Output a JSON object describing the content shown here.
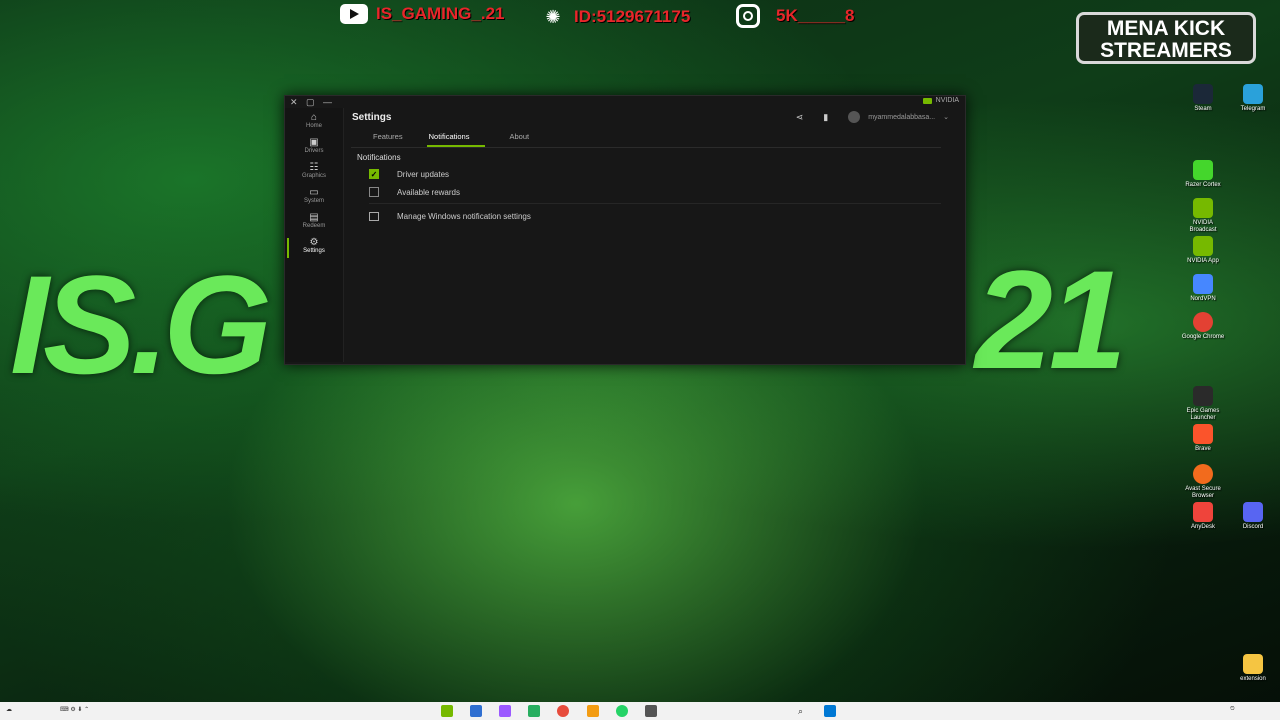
{
  "wallpaper": {
    "big_left": "IS.G",
    "big_right": "21"
  },
  "socials": {
    "youtube": "IS_GAMING_.21",
    "id": "ID:5129671175",
    "instagram": "5K_____8"
  },
  "badge": {
    "line1": "MENA KICK",
    "line2": "STREAMERS"
  },
  "window": {
    "brand": "NVIDIA",
    "title": "Settings",
    "user": "myammedalabbasa...",
    "nav": [
      {
        "label": "Home",
        "icon": "home-icon",
        "glyph": "⌂"
      },
      {
        "label": "Drivers",
        "icon": "drivers-icon",
        "glyph": "▣"
      },
      {
        "label": "Graphics",
        "icon": "graphics-icon",
        "glyph": "☷"
      },
      {
        "label": "System",
        "icon": "system-icon",
        "glyph": "▭"
      },
      {
        "label": "Redeem",
        "icon": "redeem-icon",
        "glyph": "▤"
      },
      {
        "label": "Settings",
        "icon": "gear-icon",
        "glyph": "⚙"
      }
    ],
    "tabs": [
      "Features",
      "Notifications",
      "About"
    ],
    "active_tab": "Notifications",
    "section_title": "Notifications",
    "options": [
      {
        "label": "Driver updates",
        "checked": true
      },
      {
        "label": "Available rewards",
        "checked": false
      }
    ],
    "link": "Manage Windows notification settings"
  },
  "accent_color": "#76b900",
  "desktop_icons": [
    {
      "label": "Steam",
      "color": "#1b2838"
    },
    {
      "label": "Telegram",
      "color": "#2aa1da"
    },
    {
      "label": "Razer Cortex",
      "color": "#44d62c"
    },
    {
      "label": "NVIDIA Broadcast",
      "color": "#76b900"
    },
    {
      "label": "NVIDIA App",
      "color": "#76b900"
    },
    {
      "label": "NordVPN",
      "color": "#4687ff"
    },
    {
      "label": "Google Chrome",
      "color": "#e34133"
    },
    {
      "label": "Epic Games Launcher",
      "color": "#2a2a2a"
    },
    {
      "label": "Brave",
      "color": "#fb542b"
    },
    {
      "label": "Avast Secure Browser",
      "color": "#f26b1d"
    },
    {
      "label": "AnyDesk",
      "color": "#ef443b"
    },
    {
      "label": "Discord",
      "color": "#5865f2"
    },
    {
      "label": "extension",
      "color": "#f5c542"
    }
  ],
  "taskbar_apps": [
    "#76b900",
    "#2f6fd1",
    "#9b59ff",
    "#27ae60",
    "#e74c3c",
    "#f39c12",
    "#25d366",
    "#555555"
  ]
}
